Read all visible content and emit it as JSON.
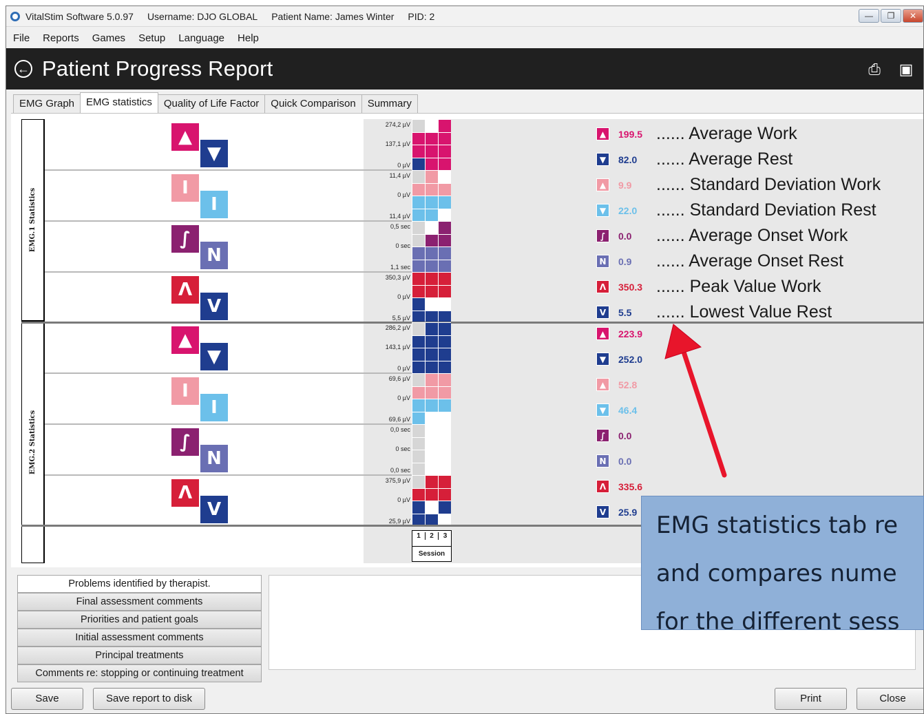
{
  "titlebar": {
    "app": "VitalStim Software 5.0.97",
    "username": "Username: DJO GLOBAL",
    "patient": "Patient Name: James Winter",
    "pid": "PID: 2"
  },
  "menu": [
    "File",
    "Reports",
    "Games",
    "Setup",
    "Language",
    "Help"
  ],
  "header": {
    "title": "Patient Progress Report"
  },
  "tabs": [
    "EMG Graph",
    "EMG statistics",
    "Quality of Life Factor",
    "Quick Comparison",
    "Summary"
  ],
  "active_tab": "EMG statistics",
  "sections": [
    {
      "label": "EMG.1 Statistics"
    },
    {
      "label": "EMG.2 Statistics"
    }
  ],
  "scales": {
    "emg1": [
      [
        "274,2 µV",
        "137,1 µV",
        "0 µV"
      ],
      [
        "11,4 µV",
        "0 µV",
        "11,4 µV"
      ],
      [
        "0,5 sec",
        "0 sec",
        "1,1 sec"
      ],
      [
        "350,3 µV",
        "0 µV",
        "5,5 µV"
      ]
    ],
    "emg2": [
      [
        "286,2 µV",
        "143,1 µV",
        "0 µV"
      ],
      [
        "69,6 µV",
        "0 µV",
        "69,6 µV"
      ],
      [
        "0,0 sec",
        "0 sec",
        "0,0 sec"
      ],
      [
        "375,9 µV",
        "0 µV",
        "25,9 µV"
      ]
    ]
  },
  "values": {
    "emg1": [
      "199.5",
      "82.0",
      "9.9",
      "22.0",
      "0.0",
      "0.9",
      "350.3",
      "5.5"
    ],
    "emg2": [
      "223.9",
      "252.0",
      "52.8",
      "46.4",
      "0.0",
      "0.0",
      "335.6",
      "25.9"
    ]
  },
  "legend": [
    "...... Average Work",
    "...... Average Rest",
    "...... Standard Deviation Work",
    "...... Standard Deviation Rest",
    "...... Average Onset Work",
    "...... Average Onset  Rest",
    "...... Peak Value Work",
    "...... Lowest Value Rest"
  ],
  "session": {
    "numbers": [
      "1",
      "2",
      "3"
    ],
    "label": "Session"
  },
  "notes_menu": [
    "Problems identified by therapist.",
    "Final assessment comments",
    "Priorities and patient goals",
    "Initial assessment comments",
    "Principal treatments",
    "Comments re: stopping or continuing treatment"
  ],
  "buttons": {
    "save": "Save",
    "save_disk": "Save report to disk",
    "print": "Print",
    "close": "Close"
  },
  "callout": {
    "lines": [
      "EMG statistics tab re",
      "and compares nume",
      "for the different sess"
    ]
  },
  "colors": {
    "avg_work": "#d8146e",
    "avg_rest": "#1f3d8f",
    "sd_work": "#f19aa5",
    "sd_rest": "#6cc0ea",
    "onset_work": "#8b2170",
    "onset_rest": "#6a6fb3",
    "peak_work": "#d61f39",
    "low_rest": "#1f3d8f"
  },
  "icons": [
    "back-arrow-icon",
    "printer-icon",
    "save-disk-icon"
  ]
}
